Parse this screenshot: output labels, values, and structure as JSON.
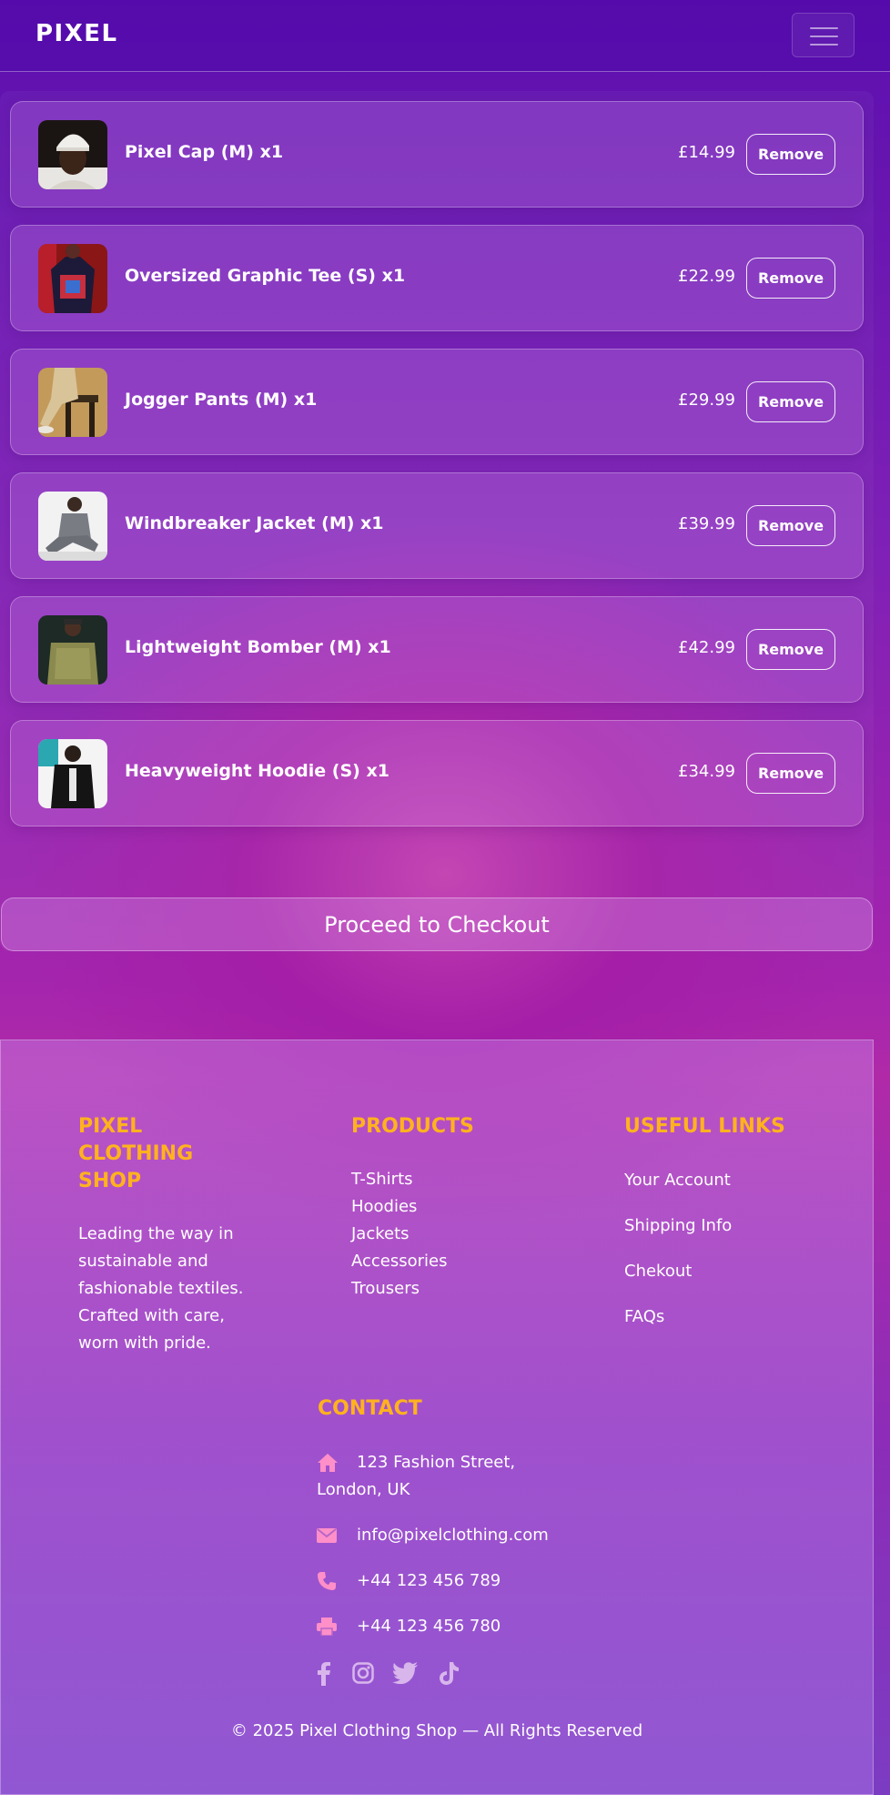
{
  "navbar": {
    "brand": "PIXEL",
    "menu_icon": "hamburger-icon"
  },
  "cart": {
    "items": [
      {
        "title": "Pixel Cap (M) x1",
        "price": "£14.99",
        "remove_label": "Remove"
      },
      {
        "title": "Oversized Graphic Tee (S) x1",
        "price": "£22.99",
        "remove_label": "Remove"
      },
      {
        "title": "Jogger Pants (M) x1",
        "price": "£29.99",
        "remove_label": "Remove"
      },
      {
        "title": "Windbreaker Jacket (M) x1",
        "price": "£39.99",
        "remove_label": "Remove"
      },
      {
        "title": "Lightweight Bomber (M) x1",
        "price": "£42.99",
        "remove_label": "Remove"
      },
      {
        "title": "Heavyweight Hoodie (S) x1",
        "price": "£34.99",
        "remove_label": "Remove"
      }
    ],
    "checkout_label": "Proceed to Checkout"
  },
  "footer": {
    "about": {
      "heading_lines": [
        "PIXEL",
        "CLOTHING",
        "SHOP"
      ],
      "text_lines": [
        "Leading the way in",
        "sustainable and",
        "fashionable textiles.",
        "Crafted with care,",
        "worn with pride."
      ]
    },
    "products": {
      "heading": "PRODUCTS",
      "links": [
        "T-Shirts",
        "Hoodies",
        "Jackets",
        "Accessories",
        "Trousers"
      ]
    },
    "useful_links": {
      "heading": "USEFUL LINKS",
      "links": [
        "Your Account",
        "Shipping Info",
        "Chekout",
        "FAQs"
      ]
    },
    "contact": {
      "heading": "CONTACT",
      "address_line1": "123 Fashion Street,",
      "address_line2": "London, UK",
      "email": "info@pixelclothing.com",
      "phone": "+44 123 456 789",
      "fax": "+44 123 456 780"
    },
    "social_icons": [
      "facebook-icon",
      "instagram-icon",
      "twitter-icon",
      "tiktok-icon"
    ],
    "copyright": "© 2025 Pixel Clothing Shop — All Rights Reserved"
  },
  "colors": {
    "accent": "#ffb21e",
    "contact_icon": "#ff8fc8",
    "background_top": "#5c0fae",
    "background_mid": "#b02aa8"
  }
}
